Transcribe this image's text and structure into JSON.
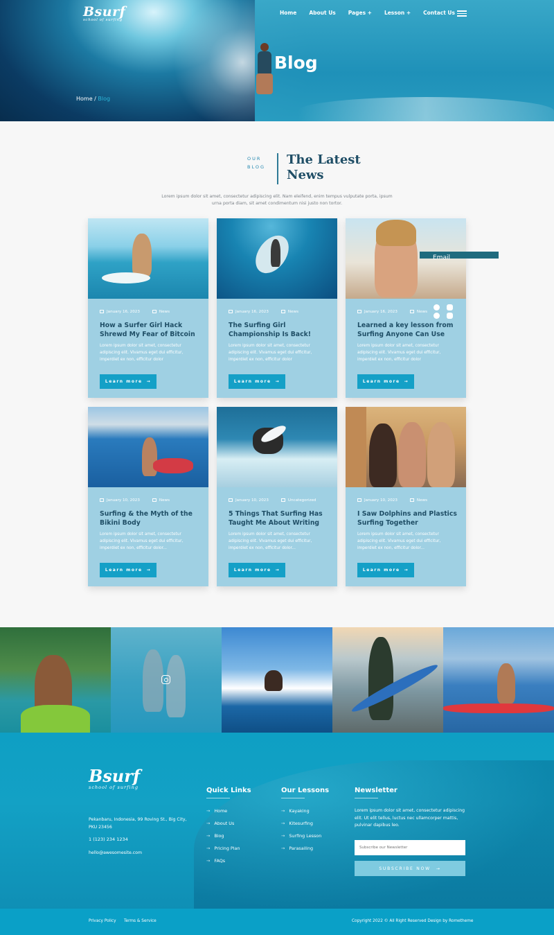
{
  "header": {
    "brand": "Bsurf",
    "tagline": "school of surfing",
    "nav": [
      "Home",
      "About Us",
      "Pages +",
      "Lesson +",
      "Contact Us"
    ],
    "hero_title": "Blog",
    "breadcrumb_home": "Home /",
    "breadcrumb_current": "Blog"
  },
  "intro": {
    "eyebrow_line1": "OUR",
    "eyebrow_line2": "BLOG",
    "title_line1": "The Latest",
    "title_line2": "News",
    "text": "Lorem ipsum dolor sit amet, consectetur adipiscing elit. Nam eleifend, enim tempus vulputate porta, ipsum urna porta diam, sit amet condimentum nisi justo non tortor."
  },
  "email_tab": "Email",
  "posts": [
    {
      "date": "January 16, 2023",
      "category": "News",
      "title": "How a Surfer Girl Hack Shrewd My Fear of Bitcoin",
      "excerpt": "Lorem ipsum dolor sit amet, consectetur adipiscing elit. Vivamus eget dui efficitur, imperdiet ex non, efficitur dolor",
      "button": "Learn more"
    },
    {
      "date": "January 16, 2023",
      "category": "News",
      "title": "The Surfing Girl Championship Is Back!",
      "excerpt": "Lorem ipsum dolor sit amet, consectetur adipiscing elit. Vivamus eget dui efficitur, imperdiet ex non, efficitur dolor",
      "button": "Learn more"
    },
    {
      "date": "January 16, 2023",
      "category": "News",
      "title": "Learned a key lesson from Surfing Anyone Can Use",
      "excerpt": "Lorem ipsum dolor sit amet, consectetur adipiscing elit. Vivamus eget dui efficitur, imperdiet ex non, efficitur dolor",
      "button": "Learn more"
    },
    {
      "date": "January 10, 2023",
      "category": "News",
      "title": "Surfing & the Myth of the Bikini Body",
      "excerpt": "Lorem ipsum dolor sit amet, consectetur adipiscing elit. Vivamus eget dui efficitur, imperdiet ex non, efficitur dolor...",
      "button": "Learn more"
    },
    {
      "date": "January 10, 2023",
      "category": "Uncategorized",
      "title": "5 Things That Surfing Has Taught Me About Writing",
      "excerpt": "Lorem ipsum dolor sit amet, consectetur adipiscing elit. Vivamus eget dui efficitur, imperdiet ex non, efficitur dolor...",
      "button": "Learn more"
    },
    {
      "date": "January 10, 2023",
      "category": "News",
      "title": "I Saw Dolphins and Plastics Surfing Together",
      "excerpt": "Lorem ipsum dolor sit amet, consectetur adipiscing elit. Vivamus eget dui efficitur, imperdiet ex non, efficitur dolor...",
      "button": "Learn more"
    }
  ],
  "footer": {
    "brand": "Bsurf",
    "tagline": "school of surfing",
    "address": "Pekanbaru, Indonesia, 99 Roving St., Big City, PKU 23456",
    "phone": "1 (123) 234 1234",
    "email": "hello@awesomesite.com",
    "quick_links_title": "Quick Links",
    "quick_links": [
      "Home",
      "About Us",
      "Blog",
      "Pricing Plan",
      "FAQs"
    ],
    "lessons_title": "Our Lessons",
    "lessons": [
      "Kayaking",
      "Kitesurfing",
      "Surfing Lesson",
      "Parasailing"
    ],
    "newsletter_title": "Newsletter",
    "newsletter_text": "Lorem ipsum dolor sit amet, consectetur adipiscing elit. Ut elit tellus, luctus nec ullamcorper mattis, pulvinar dapibus leo.",
    "newsletter_placeholder": "Subscribe our Newsletter",
    "subscribe_label": "SUBSCRIBE NOW",
    "privacy": "Privacy Policy",
    "terms": "Terms & Service",
    "copyright": "Copyright 2022 © All Right Reserved Design by Rometheme"
  },
  "colors": {
    "accent": "#14a0c7",
    "card_bg": "#9fd0e3",
    "heading": "#1f4e66",
    "footer_bg": "#0e9fc4"
  }
}
